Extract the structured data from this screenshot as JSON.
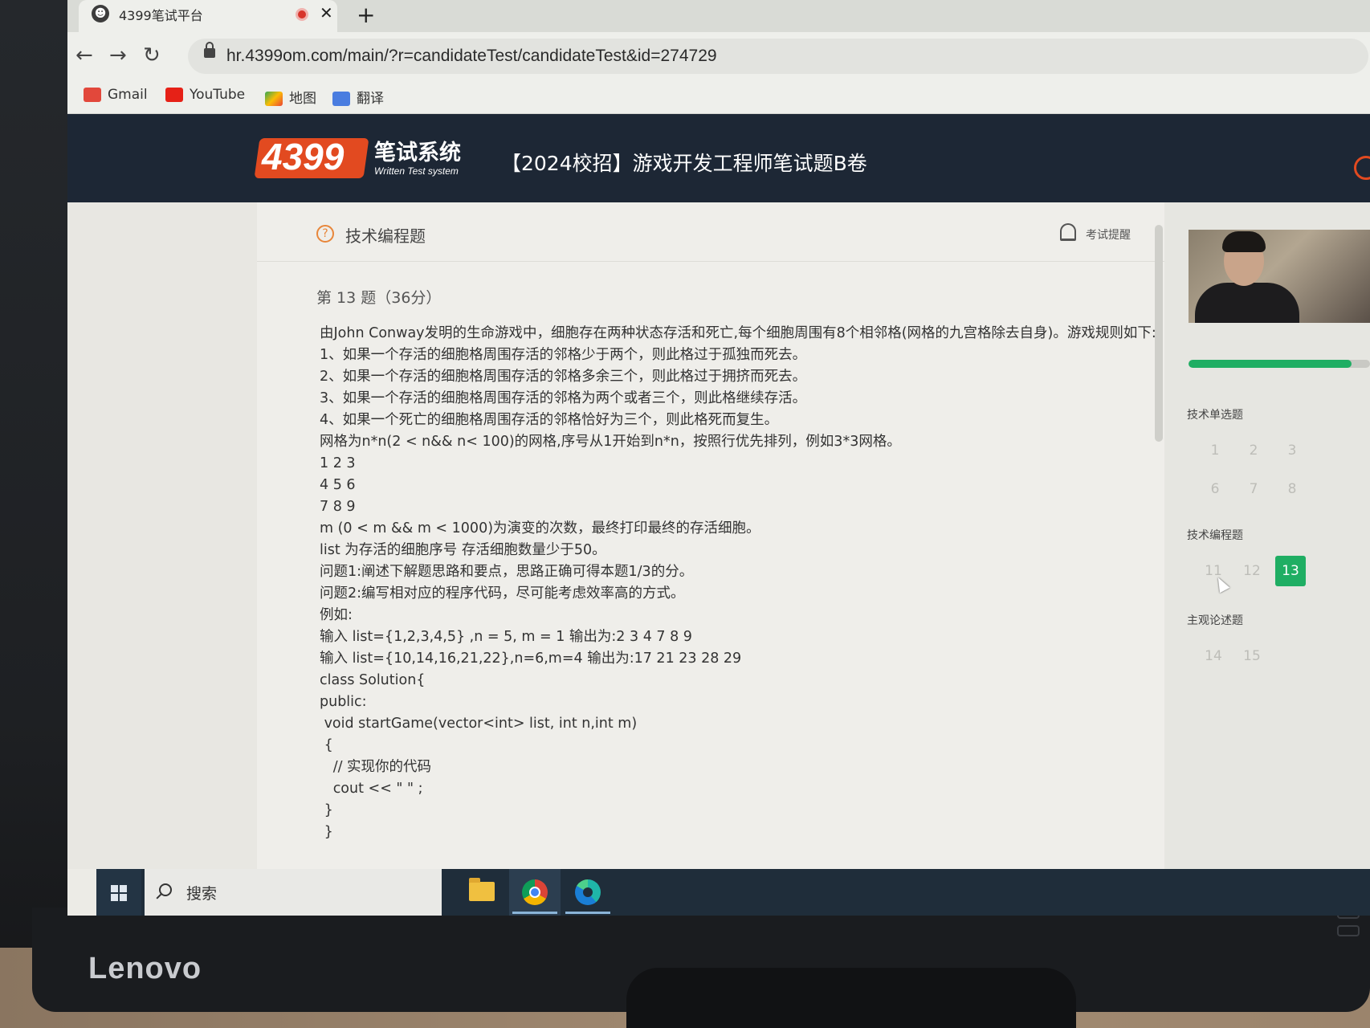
{
  "browser": {
    "tab_title": "4399笔试平台",
    "tab_close": "✕",
    "new_tab": "+",
    "url": "hr.4399om.com/main/?r=candidateTest/candidateTest&id=274729",
    "bookmarks": [
      "Gmail",
      "YouTube",
      "地图",
      "翻译"
    ]
  },
  "header": {
    "logo_number": "4399",
    "logo_cn": "笔试系统",
    "logo_en": "Written Test system",
    "exam_title": "【2024校招】游戏开发工程师笔试题B卷"
  },
  "section": {
    "title": "技术编程题",
    "reminder": "考试提醒"
  },
  "question": {
    "heading": "第 13 题（36分）",
    "lines": [
      "由John Conway发明的生命游戏中，细胞存在两种状态存活和死亡,每个细胞周围有8个相邻格(网格的九宫格除去自身)。游戏规则如下:",
      "1、如果一个存活的细胞格周围存活的邻格少于两个，则此格过于孤独而死去。",
      "2、如果一个存活的细胞格周围存活的邻格多余三个，则此格过于拥挤而死去。",
      "3、如果一个存活的细胞格周围存活的邻格为两个或者三个，则此格继续存活。",
      "4、如果一个死亡的细胞格周围存活的邻格恰好为三个，则此格死而复生。",
      "网格为n*n(2 < n&& n< 100)的网格,序号从1开始到n*n，按照行优先排列，例如3*3网格。",
      "1 2 3",
      "4 5 6",
      "7 8 9",
      "m (0 < m && m < 1000)为演变的次数，最终打印最终的存活细胞。",
      "list 为存活的细胞序号 存活细胞数量少于50。",
      "问题1:阐述下解题思路和要点，思路正确可得本题1/3的分。",
      "问题2:编写相对应的程序代码，尽可能考虑效率高的方式。",
      "例如:",
      "输入 list={1,2,3,4,5} ,n = 5, m = 1 输出为:2 3 4 7 8 9",
      "输入 list={10,14,16,21,22},n=6,m=4 输出为:17 21 23 28 29",
      "class Solution{",
      "public:",
      " void startGame(vector<int> list, int n,int m)",
      " {",
      "   // 实现你的代码",
      "   cout << \" \" ;",
      " }",
      " }"
    ]
  },
  "sidebar": {
    "progress": 0.9,
    "groups": [
      {
        "label": "技术单选题",
        "numbers": [
          "1",
          "2",
          "3",
          "6",
          "7",
          "8"
        ]
      },
      {
        "label": "技术编程题",
        "numbers": [
          "11",
          "12",
          "13"
        ]
      },
      {
        "label": "主观论述题",
        "numbers": [
          "14",
          "15"
        ]
      }
    ],
    "active": "13",
    "accent": "#1fae63"
  },
  "taskbar": {
    "search_text": "搜索"
  },
  "monitor": {
    "brand": "Lenovo"
  }
}
